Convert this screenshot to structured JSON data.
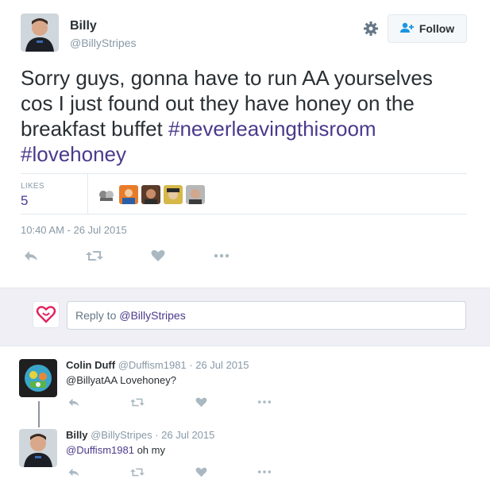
{
  "tweet": {
    "author_name": "Billy",
    "author_handle": "@BillyStripes",
    "follow_label": "Follow",
    "text_plain": "Sorry guys, gonna have to run AA yourselves cos I just found out they have honey on the breakfast buffet ",
    "hashtag1": "#neverleavingthisroom",
    "hashtag2": "#lovehoney",
    "likes_label": "LIKES",
    "likes_count": "5",
    "timestamp": "10:40 AM - 26 Jul 2015",
    "icons": [
      "gear-icon",
      "follow-person-plus-icon",
      "reply-icon",
      "retweet-icon",
      "like-heart-icon",
      "more-dots-icon"
    ]
  },
  "reply_box": {
    "prefix": "Reply to ",
    "mention": "@BillyStripes"
  },
  "replies": [
    {
      "name": "Colin Duff",
      "meta": "@Duffism1981 · 26 Jul 2015",
      "text": "@BillyatAA Lovehoney?"
    },
    {
      "name": "Billy",
      "meta": "@BillyStripes · 26 Jul 2015",
      "mention": "@Duffism1981",
      "text": " oh my"
    }
  ],
  "colors": {
    "accent": "#4b3a8c",
    "muted": "#8899a6",
    "reply_bg": "#f0eff6",
    "heart_red": "#e0245e"
  }
}
